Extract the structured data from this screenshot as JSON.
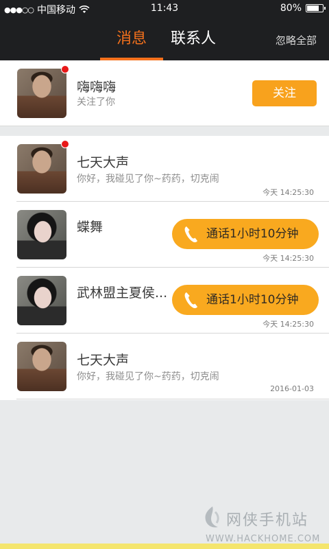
{
  "status_bar": {
    "signal": "●●●○○",
    "carrier": "中国移动",
    "time": "11:43",
    "battery": "80%",
    "battery_level": 0.8
  },
  "header": {
    "tabs": [
      {
        "label": "消息",
        "active": true
      },
      {
        "label": "联系人",
        "active": false
      }
    ],
    "ignore_all": "忽略全部"
  },
  "follow": {
    "name": "嗨嗨嗨",
    "subtitle": "关注了你",
    "button": "关注",
    "unread": true
  },
  "messages": [
    {
      "name": "七天大声",
      "preview": "你好，我碰见了你~药药，切克闹",
      "time": "今天 14:25:30",
      "unread": true
    },
    {
      "name": "蝶舞",
      "call": "通话1小时10分钟",
      "time": "今天 14:25:30",
      "unread": false
    },
    {
      "name": "武林盟主夏侯...",
      "call": "通话1小时10分钟",
      "time": "今天 14:25:30",
      "unread": false
    },
    {
      "name": "七天大声",
      "preview": "你好，我碰见了你~药药，切克闹",
      "time": "2016-01-03",
      "unread": false
    }
  ],
  "watermark": {
    "name": "网侠手机站",
    "url": "WWW.HACKHOME.COM"
  },
  "colors": {
    "accent": "#f5711c",
    "call_button": "#f9a91f",
    "unread": "#e81818",
    "header": "#1e1f21"
  }
}
